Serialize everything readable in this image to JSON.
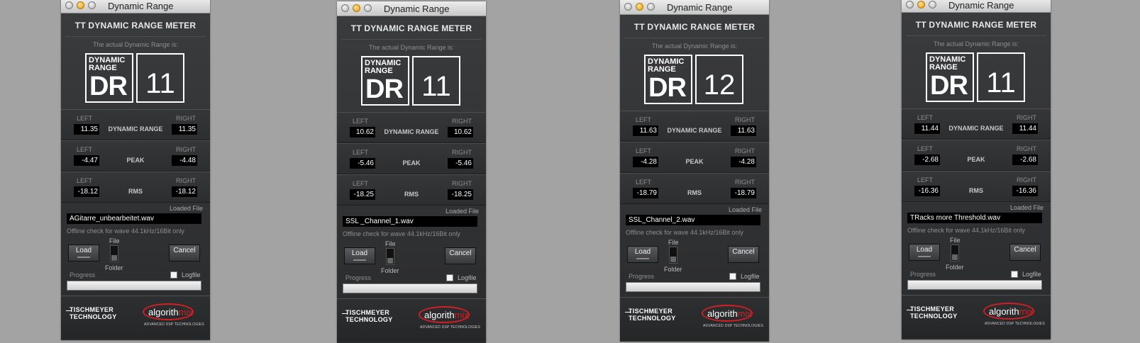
{
  "window_title": "Dynamic Range",
  "app_title": "TT DYNAMIC RANGE METER",
  "actual_label": "The actual Dynamic Range is:",
  "logo_top": "DYNAMIC RANGE",
  "logo_big": "DR",
  "left_label": "LEFT",
  "right_label": "RIGHT",
  "dr_label": "DYNAMIC RANGE",
  "peak_label": "PEAK",
  "rms_label": "RMS",
  "loaded_label": "Loaded File",
  "offline_note": "Offline check for wave 44.1kHz/16Bit only",
  "load_button": "Load",
  "cancel_button": "Cancel",
  "switch_file": "File",
  "switch_folder": "Folder",
  "progress_label": "Progress",
  "logfile_label": "Logfile",
  "brand_tischmeyer_1": "TISCHMEYER",
  "brand_tischmeyer_2": "TECHNOLOGY",
  "brand_algorithmix": "algorithmix",
  "brand_algorithmix_sub": "ADVANCED DSP TECHNOLOGIES",
  "accent_red": "#d21f24",
  "windows": [
    {
      "dr": "11",
      "dr_left": "11.35",
      "dr_right": "11.35",
      "peak_left": "-4.47",
      "peak_right": "-4.48",
      "rms_left": "-18.12",
      "rms_right": "-18.12",
      "file": "AGitarre_unbearbeitet.wav"
    },
    {
      "dr": "11",
      "dr_left": "10.62",
      "dr_right": "10.62",
      "peak_left": "-5.46",
      "peak_right": "-5.46",
      "rms_left": "-18.25",
      "rms_right": "-18.25",
      "file": "SSL _Channel_1.wav"
    },
    {
      "dr": "12",
      "dr_left": "11.63",
      "dr_right": "11.63",
      "peak_left": "-4.28",
      "peak_right": "-4.28",
      "rms_left": "-18.79",
      "rms_right": "-18.79",
      "file": "SSL_Channel_2.wav"
    },
    {
      "dr": "11",
      "dr_left": "11.44",
      "dr_right": "11.44",
      "peak_left": "-2.68",
      "peak_right": "-2.68",
      "rms_left": "-16.36",
      "rms_right": "-16.36",
      "file": "TRacks more Threshold.wav"
    }
  ]
}
